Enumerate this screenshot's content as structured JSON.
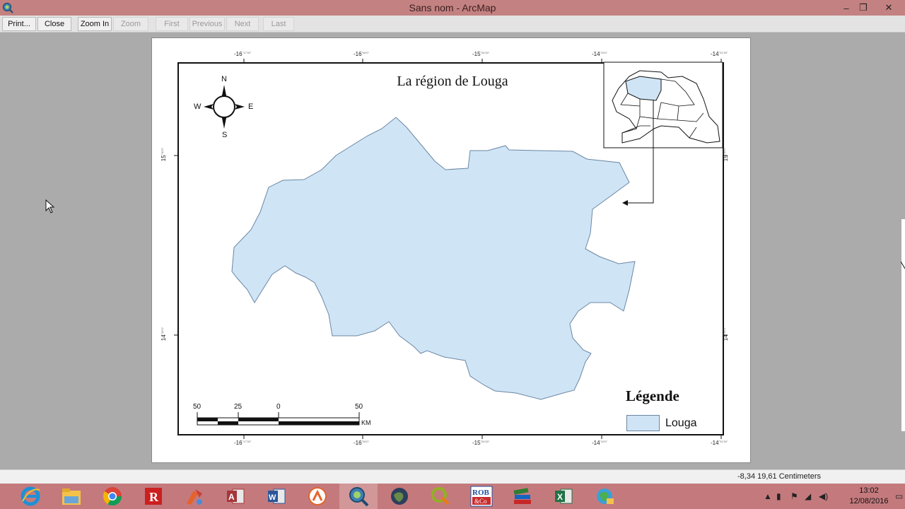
{
  "window": {
    "title": "Sans nom - ArcMap",
    "controls": {
      "minimize": "–",
      "restore": "❐",
      "close": "✕"
    }
  },
  "toolbar": {
    "print": "Print...",
    "close": "Close",
    "zoom_in": "Zoom In",
    "zoom_out": "Zoom Out",
    "first": "First",
    "previous": "Previous",
    "next": "Next",
    "last": "Last"
  },
  "map": {
    "title": "La région de Louga",
    "region_fill": "#cfe5f6",
    "compass": {
      "n": "N",
      "s": "S",
      "e": "E",
      "w": "W"
    },
    "top_ticks": [
      "-16",
      "-16",
      "-15",
      "-14",
      "-14"
    ],
    "bottom_ticks": [
      "-16",
      "-16",
      "-15",
      "-14",
      "-14"
    ],
    "left_ticks": [
      "15",
      "14"
    ],
    "right_ticks": [
      "15",
      "14"
    ],
    "scalebar": {
      "labels": [
        "50",
        "25",
        "0",
        "50"
      ],
      "unit": "KM"
    },
    "legend": {
      "title": "Légende",
      "item_label": "Louga",
      "item_color": "#cfe5f6"
    }
  },
  "statusbar": {
    "coords": "-8,34  19,61 Centimeters"
  },
  "taskbar": {
    "apps": [
      "internet-explorer",
      "file-explorer",
      "chrome",
      "red-r-app",
      "paint-app",
      "access",
      "word",
      "orange-app",
      "arcmap",
      "globe-app",
      "qgis",
      "rob-co",
      "books-app",
      "excel",
      "network-globe"
    ],
    "clock_time": "13:02",
    "clock_date": "12/08/2016"
  }
}
